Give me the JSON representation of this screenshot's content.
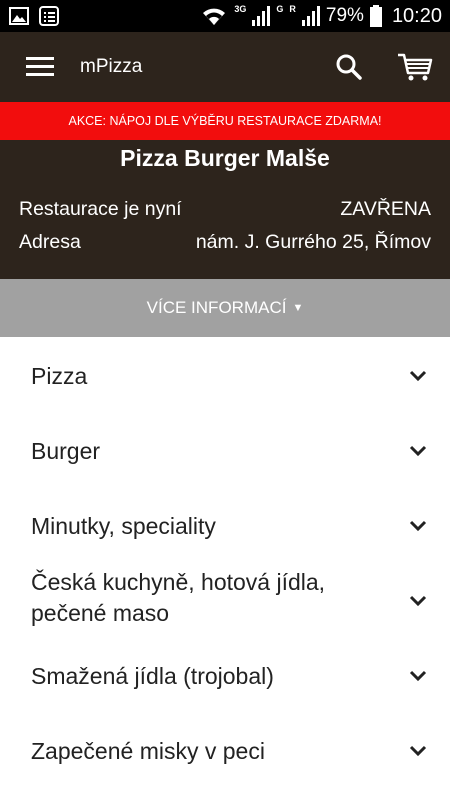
{
  "status_bar": {
    "network_3g": "3G",
    "network_g": "G",
    "network_r": "R",
    "battery": "79%",
    "time": "10:20"
  },
  "app": {
    "title": "mPizza",
    "icons": [
      "menu-icon",
      "search-icon",
      "cart-icon"
    ]
  },
  "promo": {
    "text": "AKCE: NÁPOJ DLE VÝBĚRU RESTAURACE ZDARMA!"
  },
  "restaurant": {
    "name": "Pizza Burger Malše",
    "status_label": "Restaurace je nyní",
    "status_value": "ZAVŘENA",
    "address_label": "Adresa",
    "address_value": "nám. J. Gurrého 25, Římov"
  },
  "more_info": {
    "label": "VÍCE INFORMACÍ",
    "caret": "▼"
  },
  "categories": [
    "Pizza",
    "Burger",
    "Minutky, speciality",
    "Česká kuchyně, hotová jídla, pečené maso",
    "Smažená jídla (trojobal)",
    "Zapečené misky v peci"
  ],
  "colors": {
    "toolbar": "#2d241c",
    "promo": "#f20d0d",
    "more_info_bar": "#a1a1a1"
  }
}
